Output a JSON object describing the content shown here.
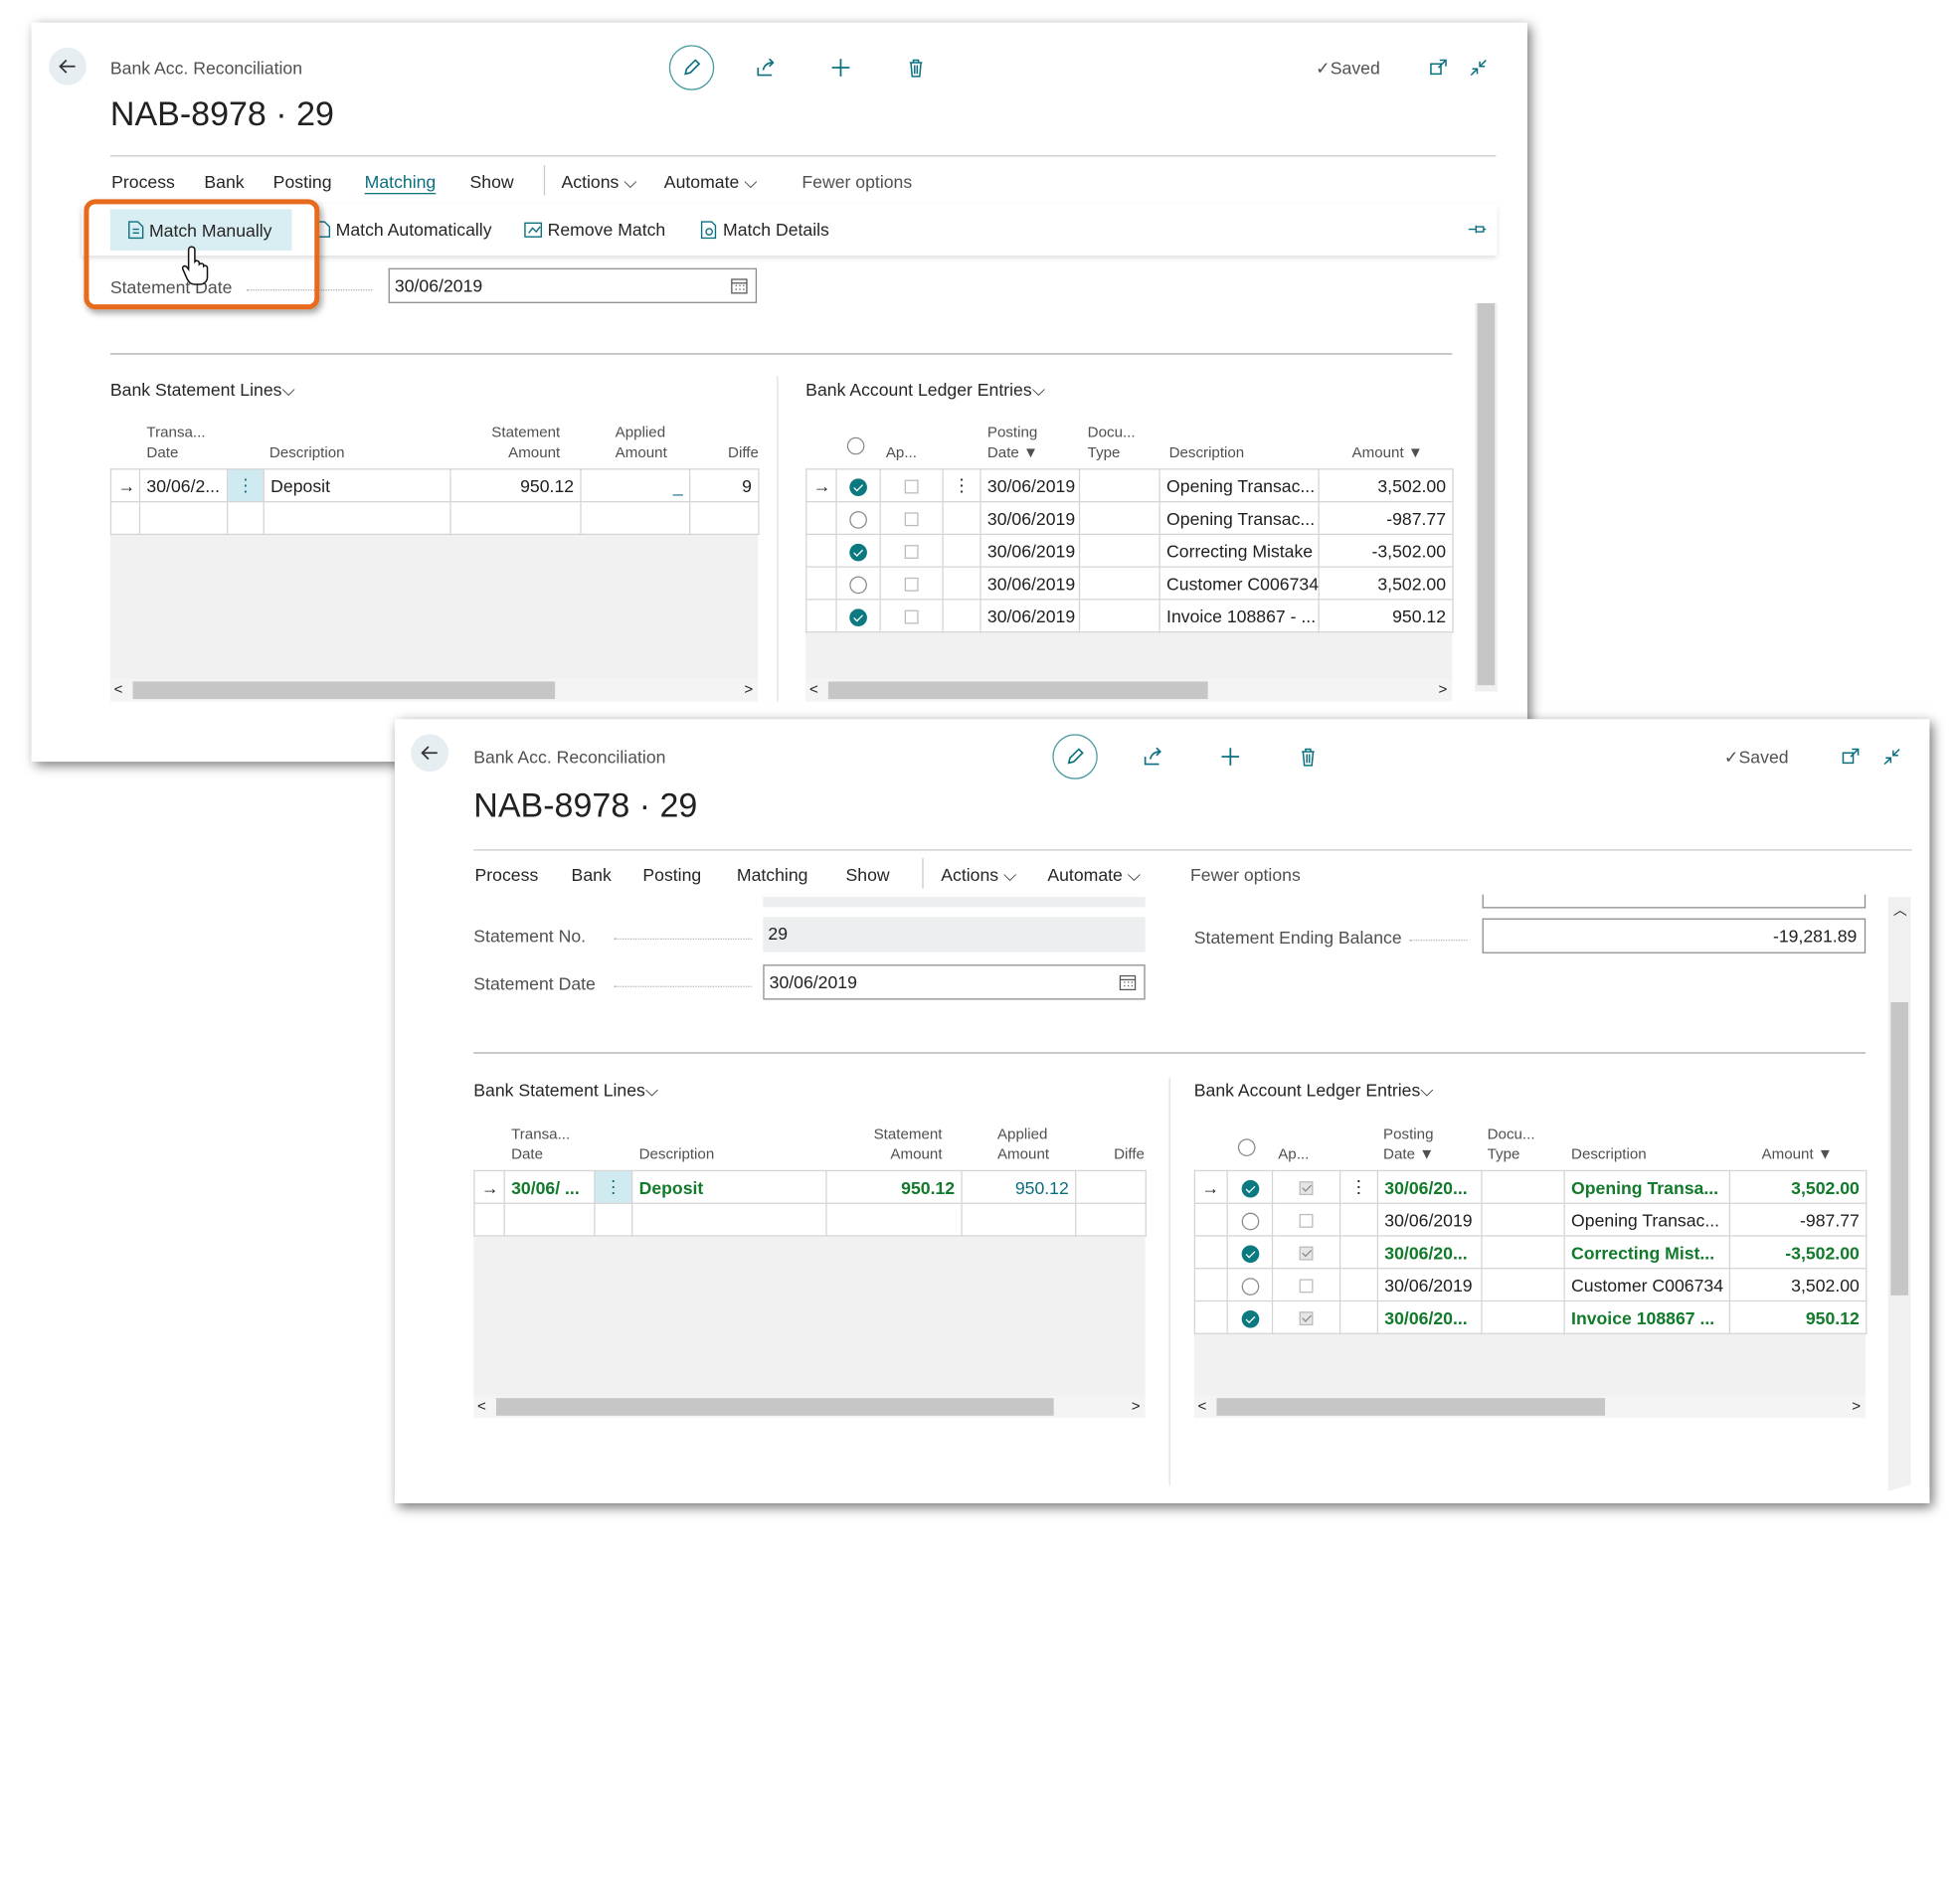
{
  "panel_top": {
    "breadcrumb": "Bank Acc. Reconciliation",
    "title": "NAB-8978 · 29",
    "saved": "Saved",
    "menu": [
      "Process",
      "Bank",
      "Posting",
      "Matching",
      "Show",
      "Actions",
      "Automate",
      "Fewer options"
    ],
    "active_menu": "Matching",
    "actions": [
      "Match Manually",
      "Match Automatically",
      "Remove Match",
      "Match Details"
    ],
    "statement_date_label": "Statement Date",
    "statement_date_value": "30/06/2019",
    "bank_lines": {
      "title": "Bank Statement Lines",
      "headers": {
        "trans_date_1": "Transa...",
        "trans_date_2": "Date",
        "description": "Description",
        "stmt_amount_1": "Statement",
        "stmt_amount_2": "Amount",
        "applied_1": "Applied",
        "applied_2": "Amount",
        "diff": "Diffe"
      },
      "row": {
        "date": "30/06/2...",
        "description": "Deposit",
        "stmt_amount": "950.12",
        "applied": "_",
        "diff": "9"
      }
    },
    "ledger": {
      "title": "Bank Account Ledger Entries",
      "headers": {
        "ap": "Ap...",
        "posting_1": "Posting",
        "posting_2": "Date",
        "doc_1": "Docu...",
        "doc_2": "Type",
        "description": "Description",
        "amount": "Amount"
      },
      "rows": [
        {
          "checked": true,
          "date": "30/06/2019",
          "description": "Opening Transac...",
          "amount": "3,502.00"
        },
        {
          "checked": false,
          "date": "30/06/2019",
          "description": "Opening Transac...",
          "amount": "-987.77"
        },
        {
          "checked": true,
          "date": "30/06/2019",
          "description": "Correcting Mistake",
          "amount": "-3,502.00"
        },
        {
          "checked": false,
          "date": "30/06/2019",
          "description": "Customer C006734",
          "amount": "3,502.00"
        },
        {
          "checked": true,
          "date": "30/06/2019",
          "description": "Invoice 108867 - ...",
          "amount": "950.12"
        }
      ]
    }
  },
  "panel_bottom": {
    "breadcrumb": "Bank Acc. Reconciliation",
    "title": "NAB-8978 · 29",
    "saved": "Saved",
    "menu": [
      "Process",
      "Bank",
      "Posting",
      "Matching",
      "Show",
      "Actions",
      "Automate",
      "Fewer options"
    ],
    "statement_no_label": "Statement No.",
    "statement_no_value": "29",
    "statement_date_label": "Statement Date",
    "statement_date_value": "30/06/2019",
    "ending_balance_label": "Statement Ending Balance",
    "ending_balance_value": "-19,281.89",
    "bank_lines": {
      "title": "Bank Statement Lines",
      "headers": {
        "trans_date_1": "Transa...",
        "trans_date_2": "Date",
        "description": "Description",
        "stmt_amount_1": "Statement",
        "stmt_amount_2": "Amount",
        "applied_1": "Applied",
        "applied_2": "Amount",
        "diff": "Diffe"
      },
      "row": {
        "date": "30/06/ ...",
        "description": "Deposit",
        "stmt_amount": "950.12",
        "applied": "950.12"
      }
    },
    "ledger": {
      "title": "Bank Account Ledger Entries",
      "headers": {
        "ap": "Ap...",
        "posting_1": "Posting",
        "posting_2": "Date",
        "doc_1": "Docu...",
        "doc_2": "Type",
        "description": "Description",
        "amount": "Amount"
      },
      "rows": [
        {
          "checked": true,
          "applied": true,
          "date": "30/06/20...",
          "description": "Opening Transa...",
          "amount": "3,502.00"
        },
        {
          "checked": false,
          "applied": false,
          "date": "30/06/2019",
          "description": "Opening Transac...",
          "amount": "-987.77"
        },
        {
          "checked": true,
          "applied": true,
          "date": "30/06/20...",
          "description": "Correcting Mist...",
          "amount": "-3,502.00"
        },
        {
          "checked": false,
          "applied": false,
          "date": "30/06/2019",
          "description": "Customer C006734",
          "amount": "3,502.00"
        },
        {
          "checked": true,
          "applied": true,
          "date": "30/06/20...",
          "description": "Invoice 108867 ...",
          "amount": "950.12"
        }
      ]
    }
  },
  "colors": {
    "accent": "#0b7a80",
    "match_green": "#117a2b",
    "highlight_orange": "#e86a1c"
  }
}
